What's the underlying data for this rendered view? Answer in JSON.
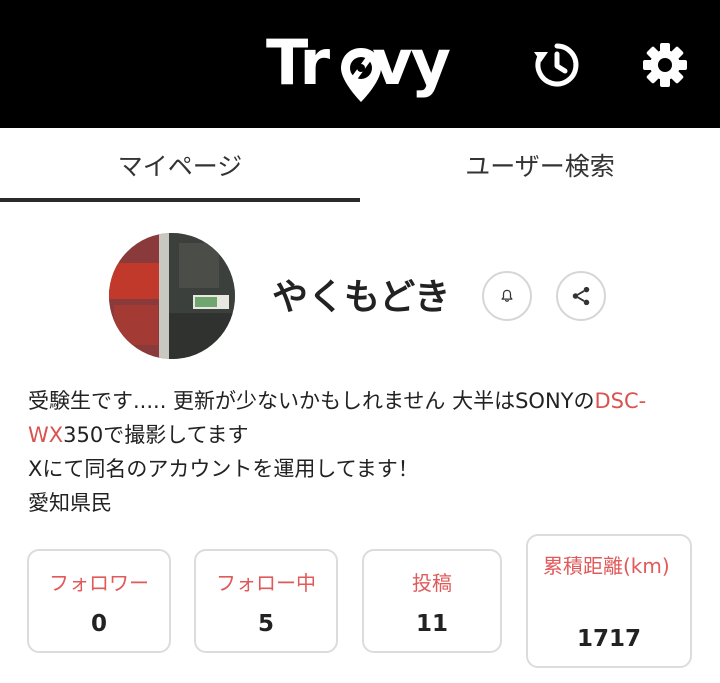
{
  "header": {
    "logo_text": "Trovy",
    "background_color": "#000000",
    "history_icon": "history-icon",
    "settings_icon": "gear-icon"
  },
  "tabs": [
    {
      "label": "マイページ",
      "active": true
    },
    {
      "label": "ユーザー検索",
      "active": false
    }
  ],
  "profile": {
    "username": "やくもどき",
    "bell_icon": "bell-icon",
    "share_icon": "share-icon",
    "bio": {
      "line1_prefix": "受験生です..... 更新が少ないかもしれません 大半はSONYの",
      "line1_link": "DSC-",
      "line2_link": "WX",
      "line2_suffix": "350で撮影してます",
      "line3": "Xにて同名のアカウントを運用してます！",
      "line4": "愛知県民"
    }
  },
  "stats": {
    "followers": {
      "label": "フォロワー",
      "value": "0"
    },
    "following": {
      "label": "フォロー中",
      "value": "5"
    },
    "posts": {
      "label": "投稿",
      "value": "11"
    },
    "distance": {
      "label": "累積距離(km)",
      "value": "1717"
    }
  },
  "colors": {
    "accent": "#e05a5a",
    "link": "#d9534f",
    "text": "#222222",
    "border": "#dcdcdc"
  }
}
